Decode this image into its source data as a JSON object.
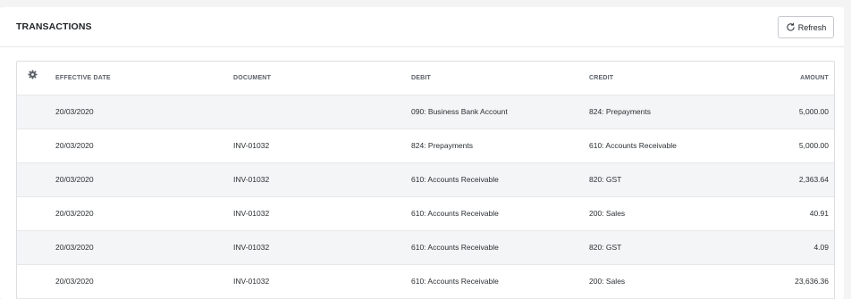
{
  "header": {
    "title": "TRANSACTIONS",
    "refresh_label": "Refresh"
  },
  "table": {
    "columns": {
      "settings_icon": "gear-icon",
      "effective_date": "EFFECTIVE DATE",
      "document": "DOCUMENT",
      "debit": "DEBIT",
      "credit": "CREDIT",
      "amount": "AMOUNT"
    },
    "rows": [
      {
        "effective_date": "20/03/2020",
        "document": "",
        "debit": "090: Business Bank Account",
        "credit": "824: Prepayments",
        "amount": "5,000.00"
      },
      {
        "effective_date": "20/03/2020",
        "document": "INV-01032",
        "debit": "824: Prepayments",
        "credit": "610: Accounts Receivable",
        "amount": "5,000.00"
      },
      {
        "effective_date": "20/03/2020",
        "document": "INV-01032",
        "debit": "610: Accounts Receivable",
        "credit": "820: GST",
        "amount": "2,363.64"
      },
      {
        "effective_date": "20/03/2020",
        "document": "INV-01032",
        "debit": "610: Accounts Receivable",
        "credit": "200: Sales",
        "amount": "40.91"
      },
      {
        "effective_date": "20/03/2020",
        "document": "INV-01032",
        "debit": "610: Accounts Receivable",
        "credit": "820: GST",
        "amount": "4.09"
      },
      {
        "effective_date": "20/03/2020",
        "document": "INV-01032",
        "debit": "610: Accounts Receivable",
        "credit": "200: Sales",
        "amount": "23,636.36"
      }
    ]
  },
  "colors": {
    "row_shade": "#f4f5f6",
    "border": "#dcdee1",
    "header_text": "#5b6168"
  }
}
